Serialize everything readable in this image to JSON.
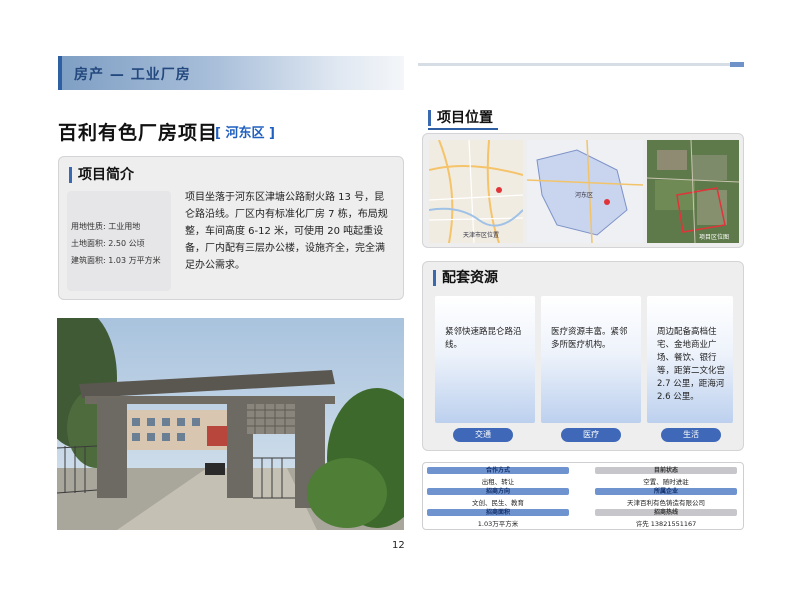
{
  "header": {
    "category": "房产 — 工业厂房"
  },
  "project": {
    "title": "百利有色厂房项目",
    "district": "[ 河东区 ]"
  },
  "intro": {
    "heading": "项目简介",
    "attributes": [
      {
        "label": "用地性质:",
        "value": "工业用地"
      },
      {
        "label": "土地面积:",
        "value": "2.50 公顷"
      },
      {
        "label": "建筑面积:",
        "value": "1.03 万平方米"
      }
    ],
    "description": "项目坐落于河东区津塘公路耐火路 13 号，昆仑路沿线。厂区内有标准化厂房 7 栋，布局规整，车间高度 6-12 米，可使用 20 吨起重设备，厂内配有三层办公楼，设施齐全，完全满足办公需求。"
  },
  "location": {
    "heading": "项目位置",
    "maps": [
      {
        "label": "天津市区位置"
      },
      {
        "label": "河东区"
      },
      {
        "label": "项目区位图"
      }
    ]
  },
  "resources": {
    "heading": "配套资源",
    "cards": [
      {
        "text": "紧邻快速路昆仑路沿线。",
        "tag": "交通"
      },
      {
        "text": "医疗资源丰富。紧邻多所医疗机构。",
        "tag": "医疗"
      },
      {
        "text": "周边配备高档住宅、金地商业广场、餐饮、银行等，距第二文化宫 2.7 公里，距海河 2.6 公里。",
        "tag": "生活"
      }
    ]
  },
  "info": {
    "items": [
      {
        "label": "合作方式",
        "value": "出租、转让",
        "style": "blue"
      },
      {
        "label": "目前状态",
        "value": "空置、随时进驻",
        "style": "gray"
      },
      {
        "label": "招商方向",
        "value": "文创、民生、教育",
        "style": "blue"
      },
      {
        "label": "所属企业",
        "value": "天津百利有色铸造有限公司",
        "style": "blue"
      },
      {
        "label": "招商面积",
        "value": "1.03万平方米",
        "style": "blue"
      },
      {
        "label": "招商热线",
        "value": "许先 13821551167",
        "style": "gray"
      }
    ]
  },
  "page": {
    "number": "12"
  },
  "colors": {
    "accent": "#2f5fa3",
    "pill": "#3f69b8",
    "panel": "#eeeeef"
  }
}
